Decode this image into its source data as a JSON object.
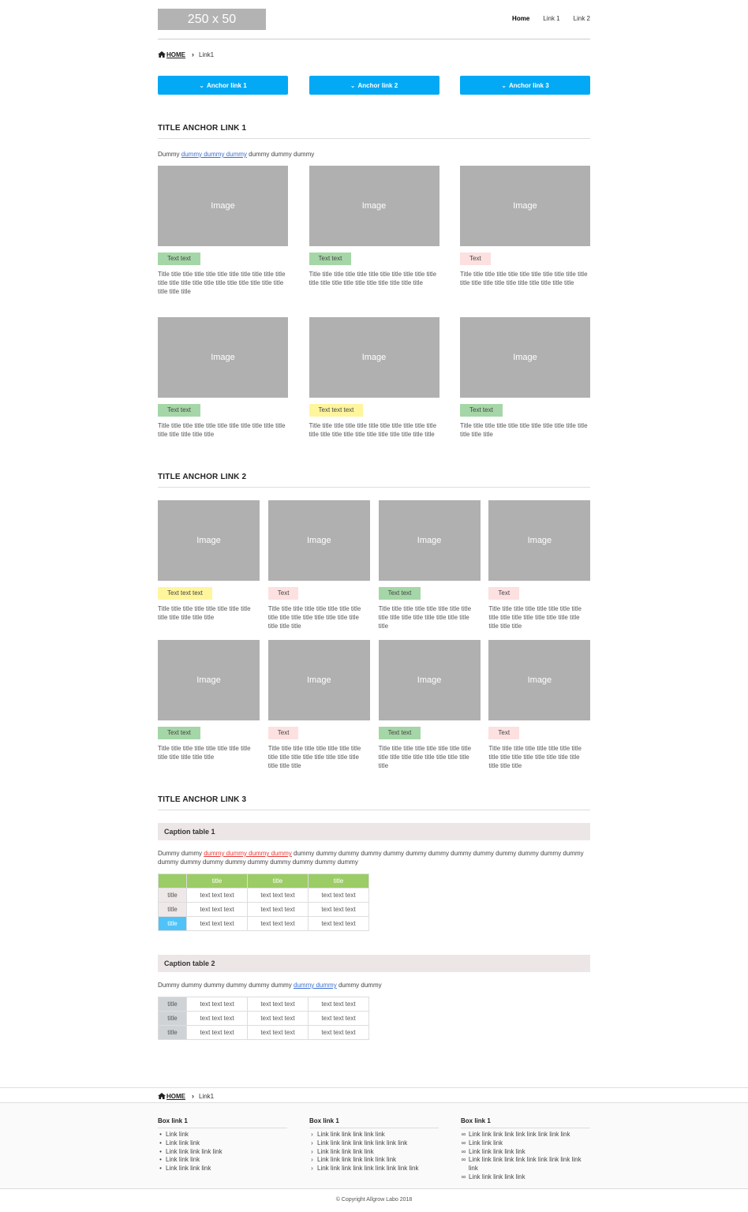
{
  "header": {
    "logo": "250 x 50",
    "nav": [
      {
        "label": "Home"
      },
      {
        "label": "Link 1"
      },
      {
        "label": "Link 2"
      }
    ]
  },
  "breadcrumb": {
    "home": "HOME",
    "current": "Link1"
  },
  "anchors": [
    {
      "label": "Anchor link 1"
    },
    {
      "label": "Anchor link 2"
    },
    {
      "label": "Anchor link 3"
    }
  ],
  "section1": {
    "title": "TITLE ANCHOR LINK 1",
    "lead_a": "Dummy ",
    "lead_link": "dummy dummy dummy",
    "lead_b": " dummy dummy dummy",
    "cards": [
      {
        "image": "Image",
        "tag": "Text text",
        "tag_color": "#a5d6a7",
        "title": "Title title title title title title title title title title title title title title title title title title title title title title title title title"
      },
      {
        "image": "Image",
        "tag": "Text text",
        "tag_color": "#a5d6a7",
        "title": "Title title title title title title title title title title title title title title title title title title title title title"
      },
      {
        "image": "Image",
        "tag": "Text",
        "tag_color": "#fde0e0",
        "title": "Title title title title title title title title title title title title title title title title title title title title title"
      },
      {
        "image": "Image",
        "tag": "Text text",
        "tag_color": "#a5d6a7",
        "title": "Title title title title title title title title title title title title title title title title"
      },
      {
        "image": "Image",
        "tag": "Text text text",
        "tag_color": "#fff59d",
        "title": "Title title title title title title title title title title title title title title title title title title title title title title"
      },
      {
        "image": "Image",
        "tag": "Text text",
        "tag_color": "#a5d6a7",
        "title": "Title title title title title title title title title title title title title title"
      }
    ]
  },
  "section2": {
    "title": "TITLE ANCHOR LINK 2",
    "cards": [
      {
        "image": "Image",
        "tag": "Text text text",
        "tag_color": "#fff59d",
        "title": "Title title title title title title title title title title title title title"
      },
      {
        "image": "Image",
        "tag": "Text",
        "tag_color": "#fde0e0",
        "title": "Title title title title title title title title title title title title title title title title title title title"
      },
      {
        "image": "Image",
        "tag": "Text text",
        "tag_color": "#a5d6a7",
        "title": "Title title title title title title title title title title title title title title title title title"
      },
      {
        "image": "Image",
        "tag": "Text",
        "tag_color": "#fde0e0",
        "title": "Title title title title title title title title title title title title title title title title title title title"
      },
      {
        "image": "Image",
        "tag": "Text text",
        "tag_color": "#a5d6a7",
        "title": "Title title title title title title title title title title title title title"
      },
      {
        "image": "Image",
        "tag": "Text",
        "tag_color": "#fde0e0",
        "title": "Title title title title title title title title title title title title title title title title title title title"
      },
      {
        "image": "Image",
        "tag": "Text text",
        "tag_color": "#a5d6a7",
        "title": "Title title title title title title title title title title title title title title title title title"
      },
      {
        "image": "Image",
        "tag": "Text",
        "tag_color": "#fde0e0",
        "title": "Title title title title title title title title title title title title title title title title title title title"
      }
    ]
  },
  "section3": {
    "title": "TITLE ANCHOR LINK 3",
    "caption1": "Caption table 1",
    "lead1_a": "Dummy dummy ",
    "lead1_link": "dummy dummy dummy dummy",
    "lead1_b": " dummy dummy dummy dummy dummy dummy dummy dummy dummy dummy dummy dummy dummy dummy dummy dummy dummy dummy dummy dummy dummy dummy",
    "table1": {
      "header": [
        "title",
        "title",
        "title"
      ],
      "rows": [
        {
          "head": "title",
          "cells": [
            "text text text",
            "text text text",
            "text text text"
          ]
        },
        {
          "head": "title",
          "cells": [
            "text text text",
            "text text text",
            "text text text"
          ]
        },
        {
          "head": "title",
          "cells": [
            "text text text",
            "text text text",
            "text text text"
          ]
        }
      ]
    },
    "caption2": "Caption table 2",
    "lead2_a": "Dummy dummy dummy dummy dummy dummy ",
    "lead2_link": "dummy dummy",
    "lead2_b": " dummy dummy",
    "table2": {
      "rows": [
        {
          "head": "title",
          "cells": [
            "text text text",
            "text text text",
            "text text text"
          ]
        },
        {
          "head": "title",
          "cells": [
            "text text text",
            "text text text",
            "text text text"
          ]
        },
        {
          "head": "title",
          "cells": [
            "text text text",
            "text text text",
            "text text text"
          ]
        }
      ]
    }
  },
  "footer": {
    "col1": {
      "title": "Box link 1",
      "items": [
        "Link link",
        "Link link link",
        "Link link link link link",
        "Link link link",
        "Link link link link"
      ]
    },
    "col2": {
      "title": "Box link 1",
      "items": [
        "Link link link link link link",
        "Link link link link link link link link",
        "Link link link link link",
        "Link link link link link link link",
        "Link link link link link link link link link"
      ]
    },
    "col3": {
      "title": "Box link 1",
      "items": [
        "Link link link link link link link link link",
        "Link link link",
        "Link link link link link",
        "Link link link link link link link link link link link",
        "Link link link link link"
      ]
    },
    "copyright": "© Copyright Allgrow Labo 2018"
  },
  "colors": {
    "accent": "#03a9f4",
    "tag_green": "#a5d6a7",
    "tag_pink": "#fde0e0",
    "tag_yellow": "#fff59d",
    "table_header": "#9ccc65",
    "caption_bg": "#ede6e6"
  }
}
